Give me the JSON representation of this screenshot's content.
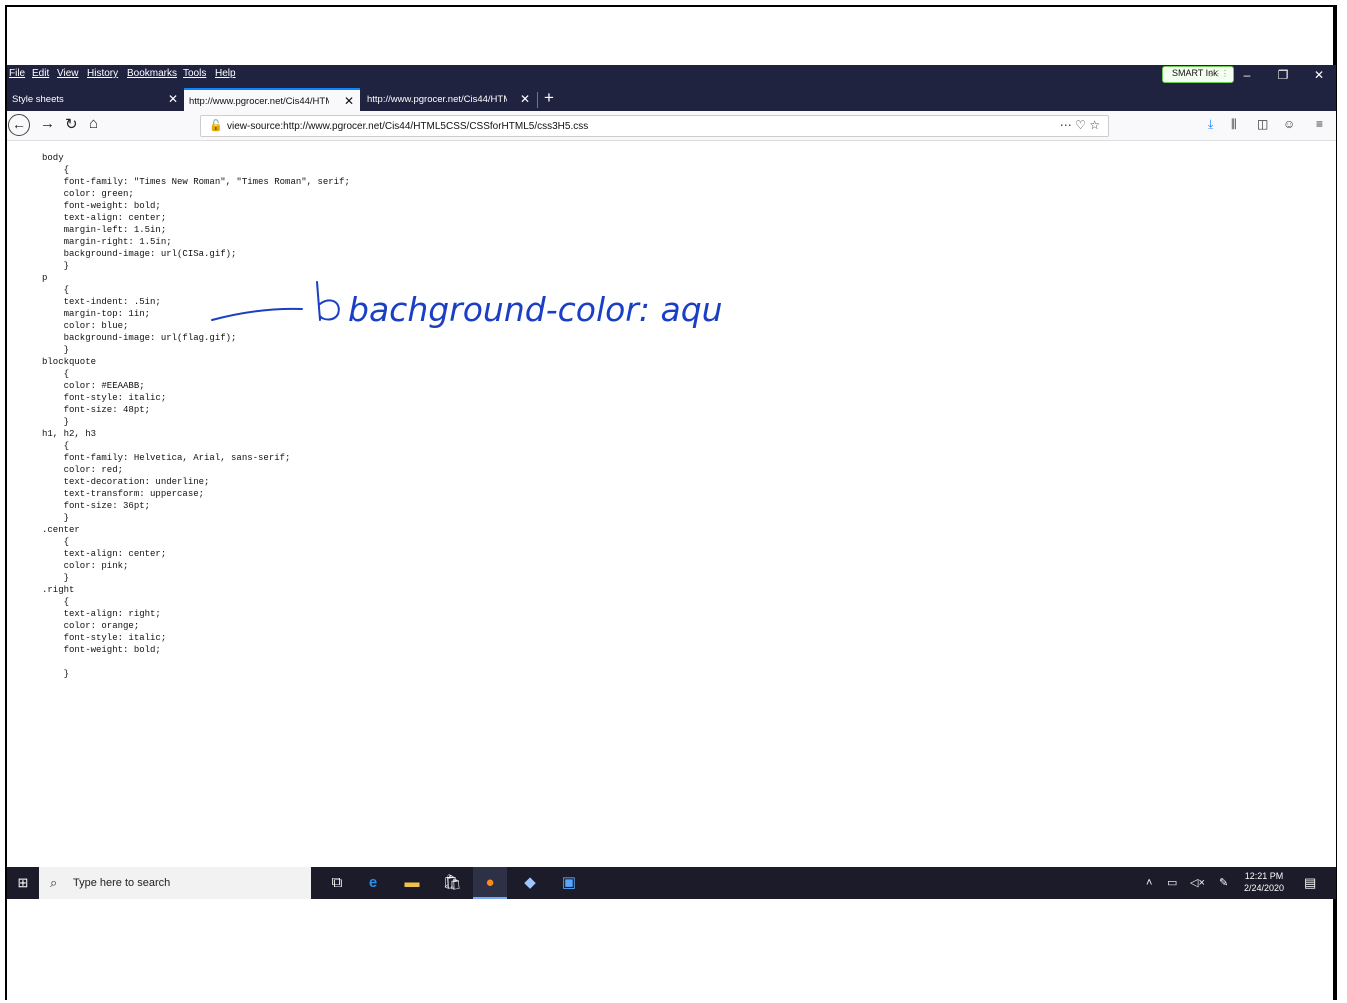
{
  "menubar": {
    "items": [
      "File",
      "Edit",
      "View",
      "History",
      "Bookmarks",
      "Tools",
      "Help"
    ],
    "smart_ink_label": "SMART Ink"
  },
  "tabs": [
    {
      "label": "Style sheets",
      "active": false
    },
    {
      "label": "http://www.pgrocer.net/Cis44/HTM",
      "active": true
    },
    {
      "label": "http://www.pgrocer.net/Cis44/HTM",
      "active": false
    }
  ],
  "url": "view-source:http://www.pgrocer.net/Cis44/HTML5CSS/CSSforHTML5/css3H5.css",
  "source_lines": [
    "body",
    "    {",
    "    font-family: \"Times New Roman\", \"Times Roman\", serif;",
    "    color: green;",
    "    font-weight: bold;",
    "    text-align: center;",
    "    margin-left: 1.5in;",
    "    margin-right: 1.5in;",
    "    background-image: url(CISa.gif);",
    "    }",
    "p",
    "    {",
    "    text-indent: .5in;",
    "    margin-top: 1in;",
    "    color: blue;",
    "    background-image: url(flag.gif);",
    "    }",
    "blockquote",
    "    {",
    "    color: #EEAABB;",
    "    font-style: italic;",
    "    font-size: 48pt;",
    "    }",
    "h1, h2, h3",
    "    {",
    "    font-family: Helvetica, Arial, sans-serif;",
    "    color: red;",
    "    text-decoration: underline;",
    "    text-transform: uppercase;",
    "    font-size: 36pt;",
    "    }",
    ".center",
    "    {",
    "    text-align: center;",
    "    color: pink;",
    "    }",
    ".right",
    "    {",
    "    text-align: right;",
    "    color: orange;",
    "    font-style: italic;",
    "    font-weight: bold;",
    "",
    "    }"
  ],
  "annotation": {
    "text": "bachground-color: aqua;",
    "ink_color": "#1a3fc4"
  },
  "taskbar": {
    "search_placeholder": "Type here to search",
    "time": "12:21 PM",
    "date": "2/24/2020"
  },
  "colors": {
    "chrome_dark": "#202340",
    "taskbar": "#1b1b2a",
    "accent": "#0a84ff"
  }
}
